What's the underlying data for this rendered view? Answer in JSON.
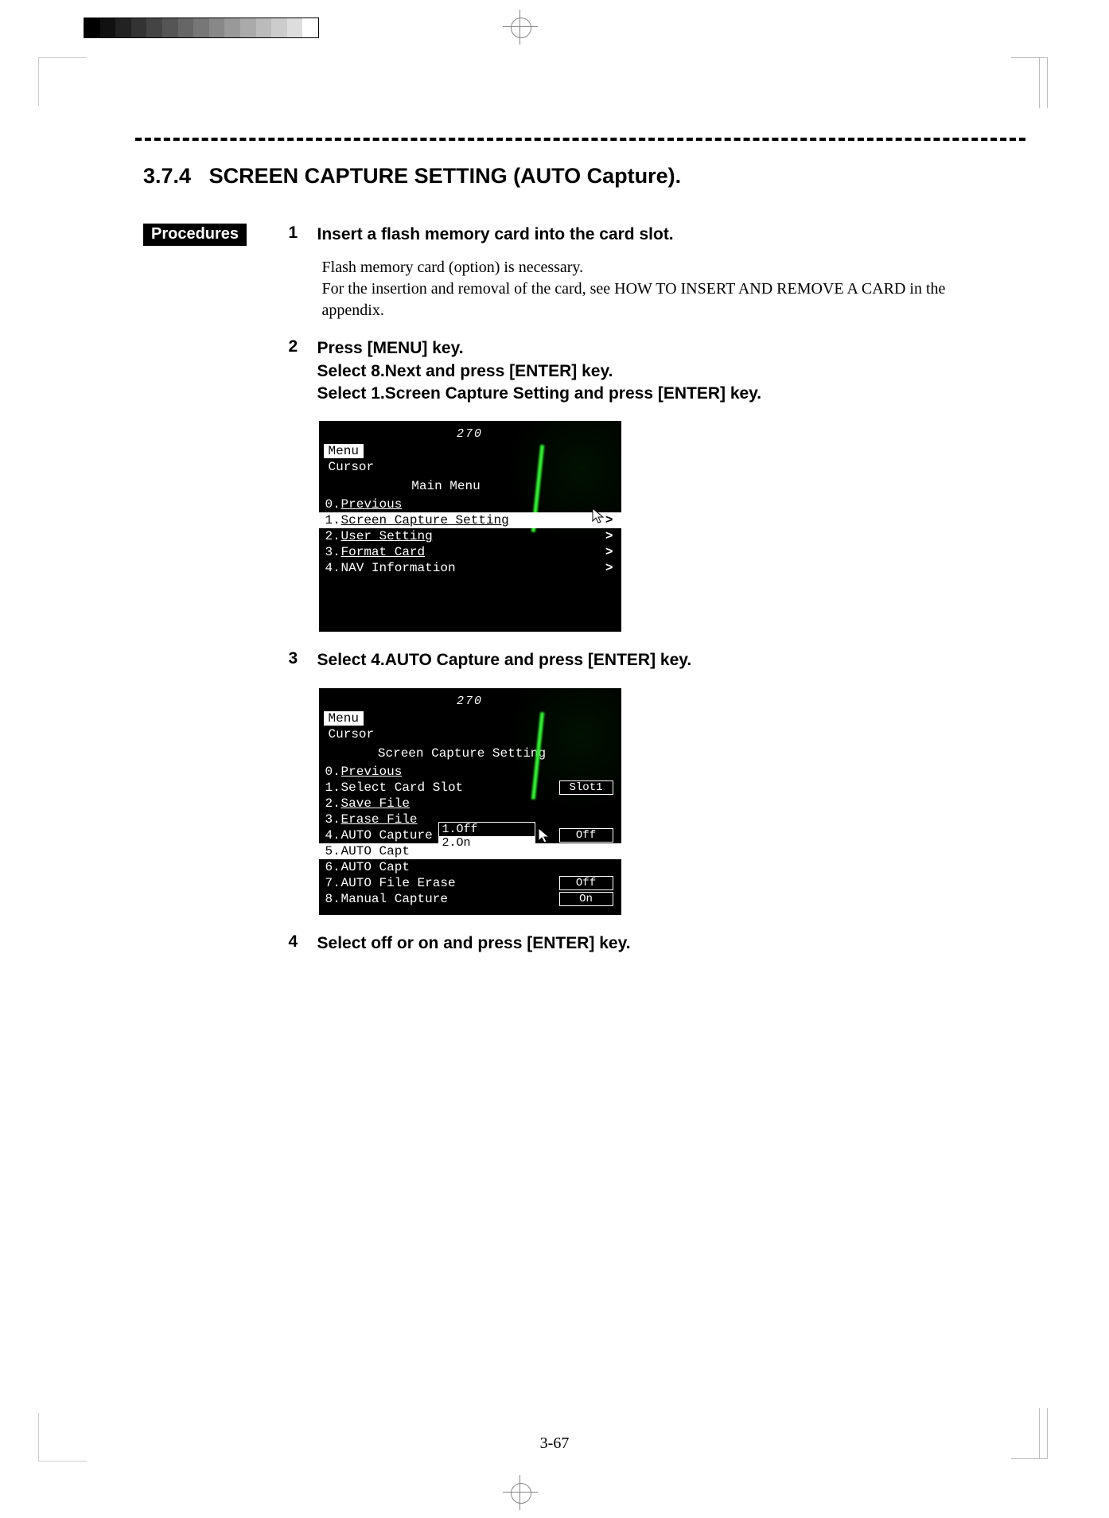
{
  "dashed_divider": true,
  "section": {
    "number": "3.7.4",
    "title": "SCREEN CAPTURE SETTING (AUTO Capture)."
  },
  "procedures_label": "Procedures",
  "steps": [
    {
      "num": "1",
      "head": "Insert a flash memory card into the card slot.",
      "body_lines": [
        "Flash memory card (option) is necessary.",
        "For the insertion and removal of the card, see HOW TO INSERT AND REMOVE A CARD in the appendix."
      ]
    },
    {
      "num": "2",
      "head_lines": [
        "Press [MENU] key.",
        "Select    8.Next    and press [ENTER] key.",
        "Select    1.Screen Capture Setting and press [ENTER] key."
      ]
    },
    {
      "num": "3",
      "head": "Select 4.AUTO Capture and press [ENTER] key."
    },
    {
      "num": "4",
      "head": "Select    off or on and press [ENTER] key."
    }
  ],
  "screenshot1": {
    "heading_indicator": "270",
    "menu_button": "Menu",
    "cursor_label": "Cursor",
    "menu_title": "Main Menu",
    "rows": [
      {
        "idx": "0.",
        "text": "Previous",
        "underline": true
      },
      {
        "idx": "1.",
        "text": "Screen Capture Setting",
        "underline": true,
        "chev": ">",
        "selected": true
      },
      {
        "idx": "2.",
        "text": "User Setting",
        "underline": true,
        "chev": ">"
      },
      {
        "idx": "3.",
        "text": "Format Card",
        "underline": true,
        "chev": ">"
      },
      {
        "idx": "4.",
        "text": "NAV Information",
        "chev": ">"
      }
    ]
  },
  "screenshot2": {
    "heading_indicator": "270",
    "menu_button": "Menu",
    "cursor_label": "Cursor",
    "menu_title": "Screen Capture Setting",
    "rows": [
      {
        "idx": "0.",
        "text": "Previous",
        "underline": true
      },
      {
        "idx": "1.",
        "text": "Select Card Slot",
        "val": "Slot1"
      },
      {
        "idx": "2.",
        "text": "Save File",
        "underline": true
      },
      {
        "idx": "3.",
        "text": "Erase File",
        "underline": true
      },
      {
        "idx": "4.",
        "text": "AUTO Capture",
        "val": "Off"
      },
      {
        "idx": "5.",
        "text": "AUTO Capt",
        "selected": true
      },
      {
        "idx": "6.",
        "text": "AUTO Capt"
      },
      {
        "idx": "7.",
        "text": "AUTO File Erase",
        "val": "Off"
      },
      {
        "idx": "8.",
        "text": "Manual Capture",
        "val": "On"
      }
    ],
    "popup": [
      {
        "idx": "1.",
        "text": "Off",
        "dark": true
      },
      {
        "idx": "2.",
        "text": "On"
      }
    ]
  },
  "page_number": "3-67"
}
